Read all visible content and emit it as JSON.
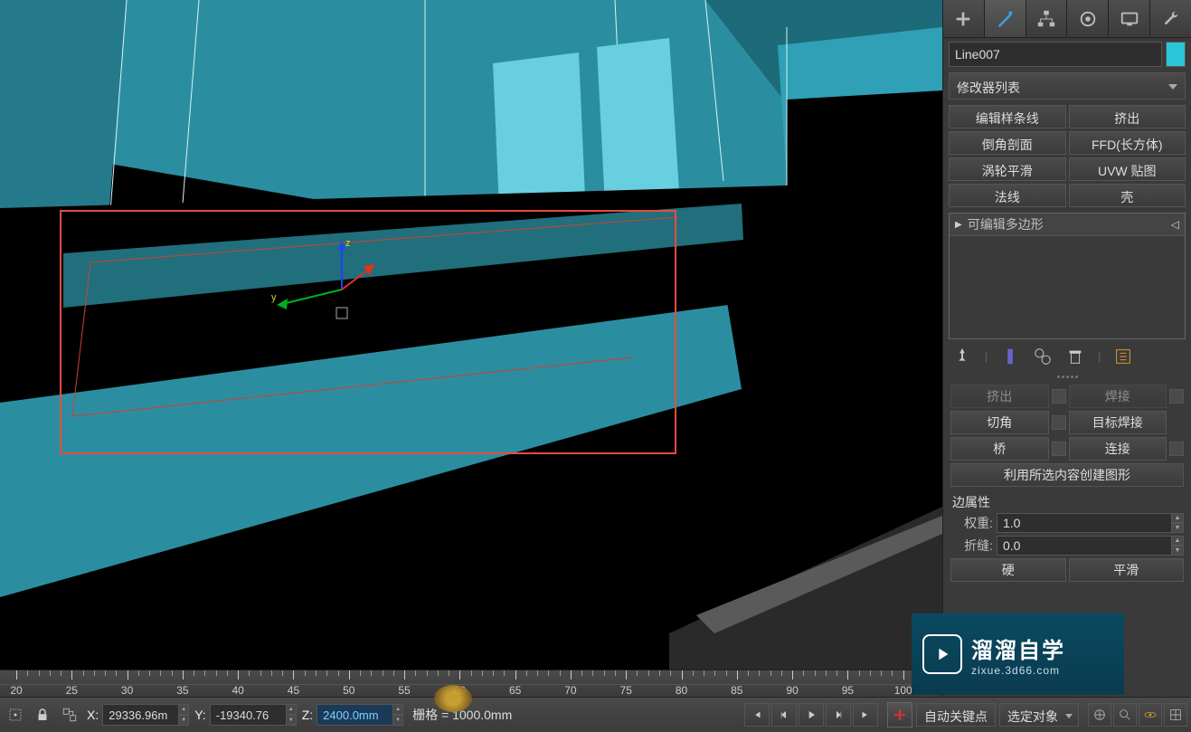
{
  "object_name": "Line007",
  "modifier_dropdown": "修改器列表",
  "modifier_buttons": {
    "edit_spline": "编辑样条线",
    "extrude": "挤出",
    "chamfer_profile": "倒角剖面",
    "ffd_box": "FFD(长方体)",
    "turbosmooth": "涡轮平滑",
    "uvw_map": "UVW 贴图",
    "normal": "法线",
    "shell": "壳"
  },
  "stack": {
    "item": "可编辑多边形"
  },
  "edit_geom": {
    "row0a": "挤出",
    "row0b": "焊接",
    "chamfer": "切角",
    "target_weld": "目标焊接",
    "bridge": "桥",
    "connect": "连接",
    "create_shape": "利用所选内容创建图形"
  },
  "edge_props": {
    "header": "边属性",
    "weight_label": "权重:",
    "weight_value": "1.0",
    "crease_label": "折缝:",
    "crease_value": "0.0",
    "hard": "硬",
    "smooth": "平滑"
  },
  "coords": {
    "x_label": "X:",
    "x_value": "29336.96m",
    "y_label": "Y:",
    "y_value": "-19340.76",
    "z_label": "Z:",
    "z_value": "2400.0mm"
  },
  "grid_label": "栅格 = 1000.0mm",
  "anim": {
    "auto_key": "自动关键点",
    "filter": "选定对象"
  },
  "timeline_labels": [
    "20",
    "25",
    "30",
    "35",
    "40",
    "45",
    "50",
    "55",
    "60",
    "65",
    "70",
    "75",
    "80",
    "85",
    "90",
    "95",
    "100"
  ],
  "watermark": {
    "title": "溜溜自学",
    "url": "zixue.3d66.com"
  }
}
